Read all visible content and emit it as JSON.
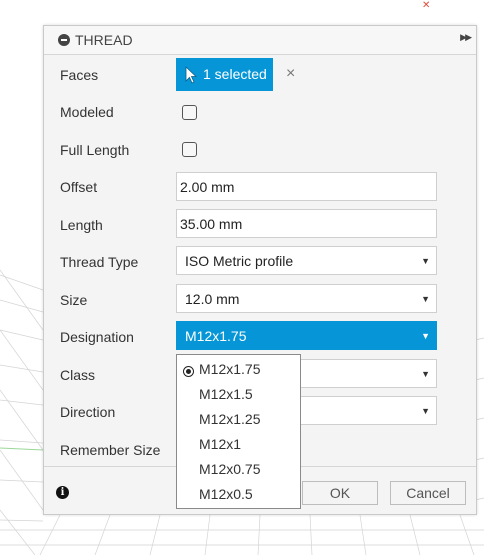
{
  "dialog": {
    "title": "THREAD",
    "faces": {
      "label": "Faces",
      "button_label": "1 selected",
      "clear_symbol": "×"
    },
    "modeled": {
      "label": "Modeled",
      "checked": false
    },
    "full_length": {
      "label": "Full Length",
      "checked": false
    },
    "offset": {
      "label": "Offset",
      "value": "2.00 mm"
    },
    "length": {
      "label": "Length",
      "value": "35.00 mm"
    },
    "thread_type": {
      "label": "Thread Type",
      "value": "ISO Metric profile"
    },
    "size": {
      "label": "Size",
      "value": "12.0 mm"
    },
    "designation": {
      "label": "Designation",
      "value": "M12x1.75",
      "options": [
        "M12x1.75",
        "M12x1.5",
        "M12x1.25",
        "M12x1",
        "M12x0.75",
        "M12x0.5"
      ],
      "selected_index": 0
    },
    "class": {
      "label": "Class",
      "value": ""
    },
    "direction": {
      "label": "Direction",
      "value": ""
    },
    "remember_size": {
      "label": "Remember Size"
    },
    "footer": {
      "ok_label": "OK",
      "cancel_label": "Cancel"
    }
  },
  "colors": {
    "accent": "#0696d7",
    "panel": "#f4f4f4"
  },
  "icons": [
    "collapse-icon",
    "expand-panel-icon",
    "cursor-arrow-icon",
    "clear-selection-icon",
    "info-icon",
    "dropdown-caret-icon"
  ]
}
